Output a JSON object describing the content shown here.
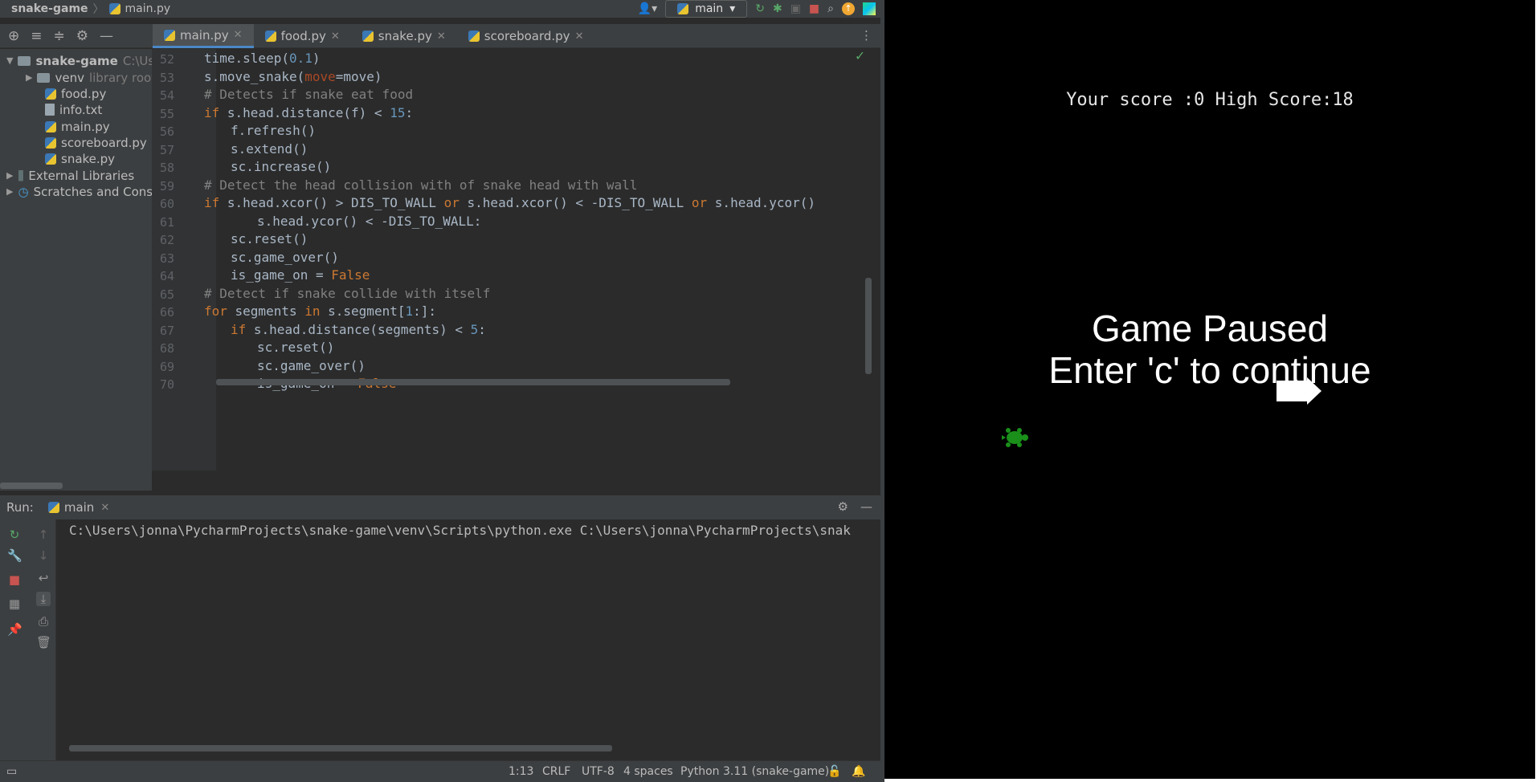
{
  "breadcrumb": {
    "project": "snake-game",
    "file": "main.py"
  },
  "run_config": {
    "label": "main"
  },
  "tabs": [
    {
      "label": "main.py"
    },
    {
      "label": "food.py"
    },
    {
      "label": "snake.py"
    },
    {
      "label": "scoreboard.py"
    }
  ],
  "project_tree": {
    "root": "snake-game",
    "root_path": "C:\\Use",
    "venv": "venv",
    "venv_note": "library root",
    "files": [
      "food.py",
      "info.txt",
      "main.py",
      "scoreboard.py",
      "snake.py"
    ],
    "external": "External Libraries",
    "scratches": "Scratches and Conso"
  },
  "editor": {
    "line_numbers": [
      "52",
      "53",
      "54",
      "55",
      "56",
      "57",
      "58",
      "59",
      "60",
      "61",
      "62",
      "63",
      "64",
      "65",
      "66",
      "67",
      "68",
      "69",
      "70"
    ]
  },
  "run_panel": {
    "label": "Run:",
    "tab": "main",
    "console": "C:\\Users\\jonna\\PycharmProjects\\snake-game\\venv\\Scripts\\python.exe C:\\Users\\jonna\\PycharmProjects\\snak"
  },
  "status": {
    "position": "1:13",
    "line_sep": "CRLF",
    "encoding": "UTF-8",
    "indent": "4 spaces",
    "interpreter": "Python 3.11 (snake-game)"
  },
  "game": {
    "score_text": "Your score :0 High Score:18",
    "pause_line1": "Game Paused",
    "pause_line2": "Enter 'c' to continue"
  },
  "colors": {
    "accent": "#4a88c7",
    "keyword": "#cc7832",
    "number": "#6897bb",
    "comment": "#808080",
    "turtle": "#1a8f1a"
  }
}
